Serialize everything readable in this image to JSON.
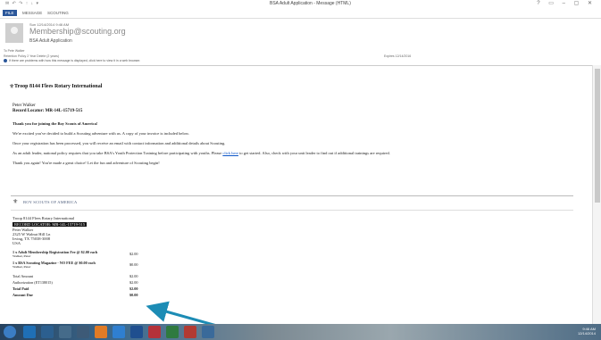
{
  "window": {
    "title": "BSA Adult Application - Message (HTML)"
  },
  "ribbon": {
    "tabs": [
      "FILE",
      "MESSAGE",
      "SCOUTING"
    ]
  },
  "header": {
    "date": "Sun 12/14/2014 9:46 AM",
    "from": "Membership@scouting.org",
    "subject": "BSA Adult Application",
    "to": "To   Pete Walker",
    "retention": "Retention Policy    2 Year Delete (2 years)",
    "expires": "Expires    12/14/2016",
    "info": "If there are problems with how this message is displayed, click here to view it in a web browser."
  },
  "body": {
    "troop": "Troop 8144 Flees Rotary International",
    "name": "Peter Walker",
    "record_locator": "Record Locator: MR-14L-15719-515",
    "thanks": "Thank you for joining the Boy Scouts of America!",
    "p1": "We're excited you've decided to build a Scouting adventure with us. A copy of your invoice is included below.",
    "p2": "Once your registration has been processed, you will receive an email with contact information and additional details about Scouting.",
    "p3_pre": "As an adult leader, national policy requires that you take BSA's Youth Protection Training before participating with youths. Please",
    "p3_link": "click here",
    "p3_post": "to get started. Also, check with your unit leader to find out if additional trainings are required.",
    "p4": "Thank you again! You're made a great choice! Let the fun and adventure of Scouting begin!"
  },
  "invoice": {
    "logo_text": "BOY SCOUTS OF AMERICA",
    "org": "Troop 8144 Flees Rotary International",
    "record_locator": "RECORD LOCATOR: MR-14L-15719-515",
    "address": [
      "Peter Walker",
      "2325 W Walnut Hill Ln",
      "Irving, TX 75038-3008",
      "USA"
    ],
    "lines": [
      {
        "label": "1 x Adult Membership Registration Fee @ $2.00 each",
        "sub": "Walker, Peter",
        "value": "$2.00"
      },
      {
        "label": "1 x BSA Scouting Magazine - NO FEE @ $0.00 each",
        "sub": "Walker, Peter",
        "value": "$0.00"
      }
    ],
    "total_amount": {
      "label": "Total Amount",
      "value": "$2.00"
    },
    "authorization": {
      "label": "Authorization (ET138015)",
      "value": "$2.00"
    },
    "total_paid": {
      "label": "Total Paid",
      "value": "$2.00"
    },
    "amount_due": {
      "label": "Amount Due",
      "value": "$0.00"
    }
  },
  "taskbar": {
    "time": "9:46 AM",
    "date": "12/14/2014"
  },
  "colors": {
    "accent": "#2b579a",
    "arrow": "#1c8cb5",
    "link": "#0b55c8"
  }
}
